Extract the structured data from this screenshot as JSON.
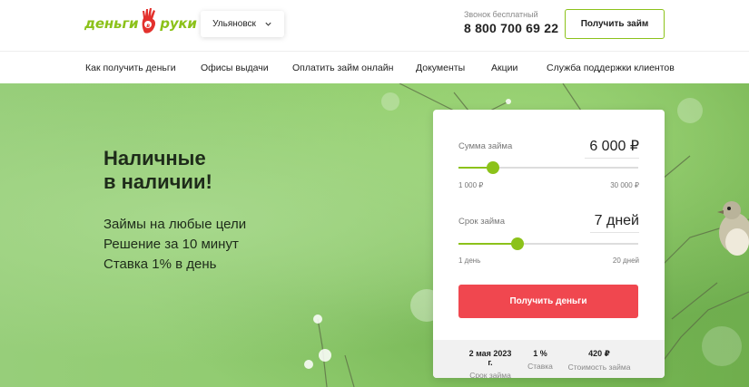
{
  "header": {
    "logo_left": "деньги",
    "logo_right": "руки",
    "city": "Ульяновск",
    "phone_label": "Звонок бесплатный",
    "phone": "8 800 700 69 22",
    "cta": "Получить займ"
  },
  "nav": {
    "items": [
      "Как получить деньги",
      "Офисы выдачи",
      "Оплатить займ онлайн",
      "Документы",
      "Акции",
      "Служба поддержки клиентов"
    ]
  },
  "hero": {
    "title_line1": "Наличные",
    "title_line2": "в наличии!",
    "bullets": [
      "Займы на любые цели",
      "Решение за 10 минут",
      "Ставка 1% в день"
    ]
  },
  "calculator": {
    "amount": {
      "label": "Сумма займа",
      "value": "6 000 ₽",
      "min_label": "1 000 ₽",
      "max_label": "30 000 ₽",
      "level": 0.19
    },
    "term": {
      "label": "Срок займа",
      "value": "7 дней",
      "min_label": "1 день",
      "max_label": "20 дней",
      "level": 0.33
    },
    "submit": "Получить деньги",
    "summary": [
      {
        "value": "2 мая 2023 г.",
        "label": "Срок займа"
      },
      {
        "value": "1 %",
        "label": "Ставка"
      },
      {
        "value": "420 ₽",
        "label": "Стоимость займа"
      }
    ]
  },
  "colors": {
    "brand_green": "#8cc21a",
    "button_red": "#f0474f",
    "logo_red": "#e3312d"
  },
  "icons": [
    "chevron-down-icon",
    "hand-logo-icon"
  ]
}
